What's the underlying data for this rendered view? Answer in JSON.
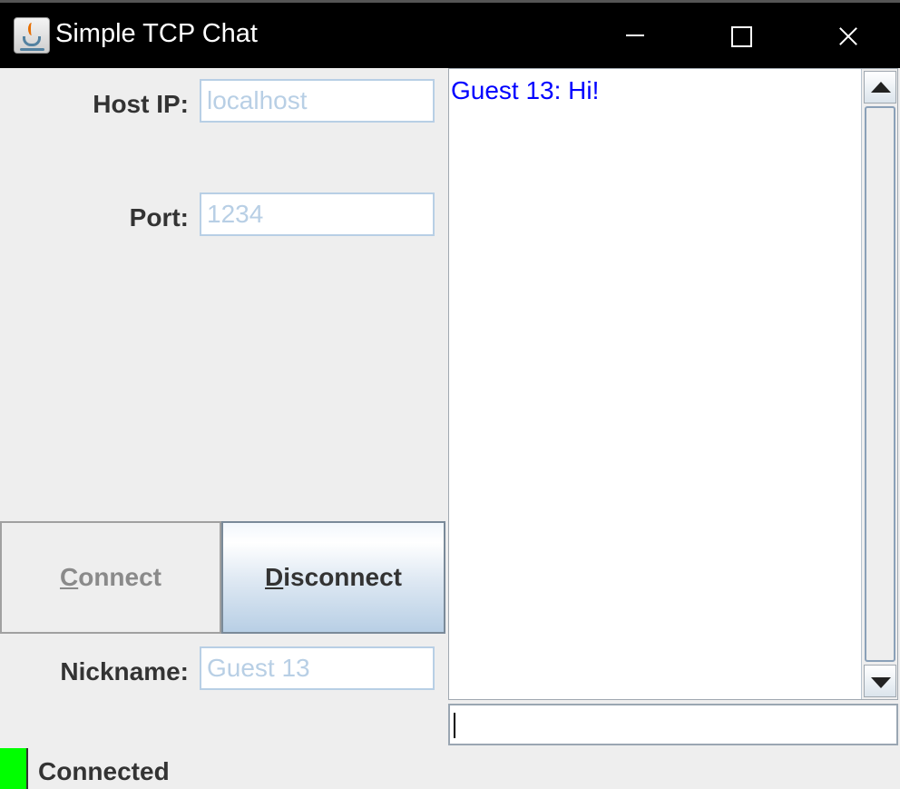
{
  "window": {
    "title": "Simple TCP Chat",
    "app_icon": "java-icon",
    "controls": {
      "minimize": "minimize-icon",
      "maximize": "maximize-icon",
      "close": "close-icon"
    }
  },
  "connection_form": {
    "host_label": "Host IP:",
    "host_value": "localhost",
    "port_label": "Port:",
    "port_value": "1234",
    "connect_button": {
      "mnemonic": "C",
      "rest": "onnect",
      "enabled": false
    },
    "disconnect_button": {
      "mnemonic": "D",
      "rest": "isconnect",
      "enabled": true
    },
    "nickname_label": "Nickname:",
    "nickname_value": "Guest 13"
  },
  "chat": {
    "messages": [
      {
        "text": "Guest 13: Hi!",
        "color": "#0000ff"
      }
    ],
    "input_value": ""
  },
  "status": {
    "indicator_color": "#00ff00",
    "text": "Connected"
  }
}
